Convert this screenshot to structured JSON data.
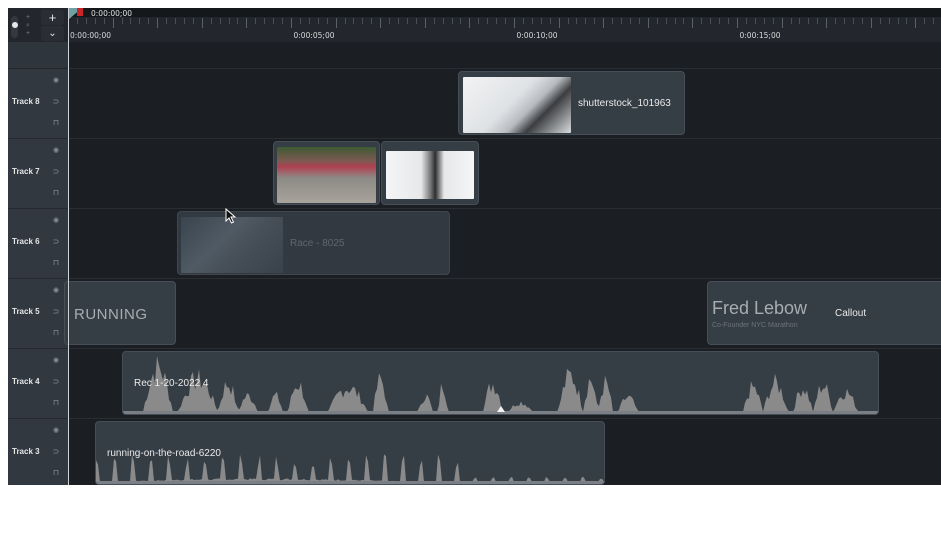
{
  "header": {
    "add_track_label": "+",
    "collapse_label": "⌄",
    "zoom_icon": "zoom-magnifier-icon",
    "playhead_time": "0:00:00;00"
  },
  "ruler": {
    "labels": [
      "0:00:00;00",
      "0:00:05;00",
      "0:00:10;00",
      "0:00:15;00"
    ]
  },
  "tracks": [
    {
      "name": "Track 8",
      "icons": [
        "eye-icon",
        "link-icon",
        "lock-icon"
      ]
    },
    {
      "name": "Track 7",
      "icons": [
        "eye-icon",
        "link-icon",
        "lock-icon"
      ]
    },
    {
      "name": "Track 6",
      "icons": [
        "eye-icon",
        "link-icon",
        "lock-icon"
      ]
    },
    {
      "name": "Track 5",
      "icons": [
        "eye-icon",
        "link-icon",
        "lock-icon"
      ]
    },
    {
      "name": "Track 4",
      "icons": [
        "eye-icon",
        "link-icon",
        "lock-icon"
      ]
    },
    {
      "name": "Track 3",
      "icons": [
        "eye-icon",
        "link-icon",
        "lock-icon"
      ]
    }
  ],
  "clips": {
    "track8": {
      "label": "shutterstock_101963",
      "type": "video"
    },
    "track7a": {
      "label": "",
      "type": "video"
    },
    "track7b": {
      "label": "",
      "type": "video"
    },
    "track6": {
      "label": "Race - 8025",
      "type": "video",
      "state": "disabled"
    },
    "track5a": {
      "label": "RUNNING",
      "type": "title"
    },
    "track5b": {
      "title": "Fred Lebow",
      "subtitle": "Co-Founder NYC Marathon",
      "label": "Callout",
      "type": "callout"
    },
    "track4": {
      "label": "Rec 1-20-2022 4",
      "type": "audio"
    },
    "track3": {
      "label": "running-on-the-road-6220",
      "type": "audio"
    }
  },
  "colors": {
    "background": "#1b1e22",
    "clip": "#353d45",
    "track_header": "#313840",
    "playhead_red": "#c8262b",
    "playhead_teal": "#6fa0a3",
    "waveform": "#8a8a8a"
  }
}
